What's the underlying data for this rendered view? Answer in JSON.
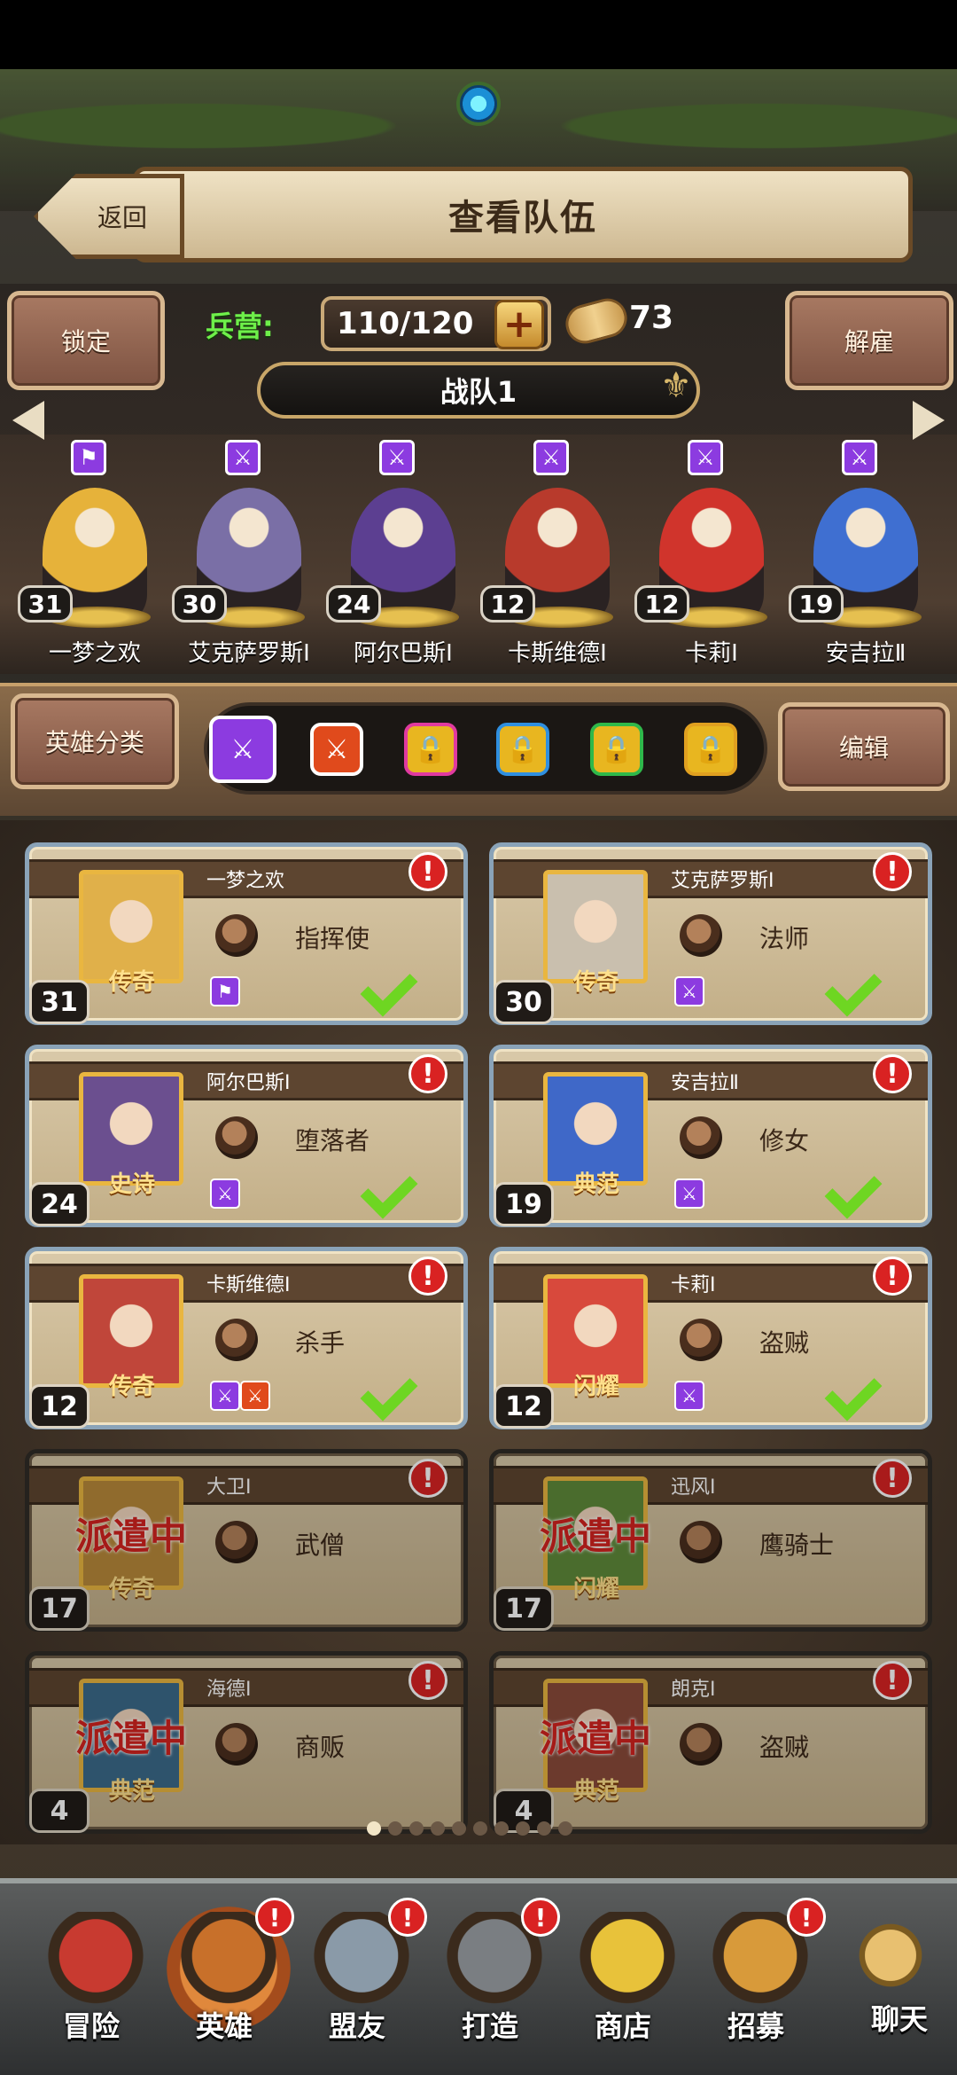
{
  "header": {
    "back_label": "返回",
    "title": "查看队伍",
    "lock_label": "锁定",
    "dismiss_label": "解雇",
    "barracks_label": "兵营:",
    "barracks_value": "110/120",
    "scroll_count": "73",
    "team_name": "战队1"
  },
  "lineup": [
    {
      "name": "一梦之欢",
      "level": "31",
      "tag": "flag",
      "color": "#e6b23a"
    },
    {
      "name": "艾克萨罗斯Ⅰ",
      "level": "30",
      "tag": "sword",
      "color": "#7a6fa6"
    },
    {
      "name": "阿尔巴斯Ⅰ",
      "level": "24",
      "tag": "sword",
      "color": "#5c3f91"
    },
    {
      "name": "卡斯维德Ⅰ",
      "level": "12",
      "tag": "sword",
      "color": "#b83a2c"
    },
    {
      "name": "卡莉Ⅰ",
      "level": "12",
      "tag": "sword",
      "color": "#d0342c"
    },
    {
      "name": "安吉拉Ⅱ",
      "level": "19",
      "tag": "sword",
      "color": "#3f6fd1"
    }
  ],
  "filter": {
    "category_label": "英雄分类",
    "edit_label": "编辑",
    "tabs": [
      {
        "icon": "sword-icon",
        "color": "#8c3be0",
        "locked": false
      },
      {
        "icon": "sword-icon",
        "color": "#e04a1c",
        "locked": false
      },
      {
        "icon": "lock-icon",
        "color": "#e03aa0",
        "locked": true
      },
      {
        "icon": "lock-icon",
        "color": "#2f8fe0",
        "locked": true
      },
      {
        "icon": "lock-icon",
        "color": "#2fb84a",
        "locked": true
      },
      {
        "icon": "lock-icon",
        "color": "#e0a020",
        "locked": true
      }
    ]
  },
  "heroes": [
    {
      "name": "一梦之欢",
      "job": "指挥使",
      "level": "31",
      "rank": "传奇",
      "portrait": "#e0b04a",
      "tags": [
        "flag"
      ],
      "status": "ready"
    },
    {
      "name": "艾克萨罗斯Ⅰ",
      "job": "法师",
      "level": "30",
      "rank": "传奇",
      "portrait": "#c9bfae",
      "tags": [
        "sword"
      ],
      "status": "ready"
    },
    {
      "name": "阿尔巴斯Ⅰ",
      "job": "堕落者",
      "level": "24",
      "rank": "史诗",
      "portrait": "#6b4f8f",
      "tags": [
        "sword"
      ],
      "status": "ready"
    },
    {
      "name": "安吉拉Ⅱ",
      "job": "修女",
      "level": "19",
      "rank": "典范",
      "portrait": "#3f68c8",
      "tags": [
        "sword"
      ],
      "status": "ready"
    },
    {
      "name": "卡斯维德Ⅰ",
      "job": "杀手",
      "level": "12",
      "rank": "传奇",
      "portrait": "#c0463a",
      "tags": [
        "sword",
        "sword-red"
      ],
      "status": "ready"
    },
    {
      "name": "卡莉Ⅰ",
      "job": "盗贼",
      "level": "12",
      "rank": "闪耀",
      "portrait": "#d8493c",
      "tags": [
        "sword"
      ],
      "status": "ready"
    },
    {
      "name": "大卫Ⅰ",
      "job": "武僧",
      "level": "17",
      "rank": "传奇",
      "portrait": "#b9893a",
      "tags": [],
      "status": "派遣中"
    },
    {
      "name": "迅风Ⅰ",
      "job": "鹰骑士",
      "level": "17",
      "rank": "闪耀",
      "portrait": "#5f8a3a",
      "tags": [],
      "status": "派遣中"
    },
    {
      "name": "海德Ⅰ",
      "job": "商贩",
      "level": "4",
      "rank": "典范",
      "portrait": "#3b6a8a",
      "tags": [],
      "status": "派遣中"
    },
    {
      "name": "朗克Ⅰ",
      "job": "盗贼",
      "level": "4",
      "rank": "典范",
      "portrait": "#8a4a3a",
      "tags": [],
      "status": "派遣中"
    }
  ],
  "pager": {
    "pages": 10,
    "current": 0
  },
  "nav": [
    {
      "label": "冒险",
      "icon": "crossed-swords-icon",
      "badge": false
    },
    {
      "label": "英雄",
      "icon": "knight-helmet-icon",
      "badge": true,
      "active": true
    },
    {
      "label": "盟友",
      "icon": "handshake-icon",
      "badge": true
    },
    {
      "label": "打造",
      "icon": "hammer-icon",
      "badge": true
    },
    {
      "label": "商店",
      "icon": "gold-bars-icon",
      "badge": false
    },
    {
      "label": "招募",
      "icon": "barrel-portal-icon",
      "badge": true
    },
    {
      "label": "聊天",
      "icon": "chat-bubble-icon",
      "badge": false
    }
  ],
  "alert_glyph": "!",
  "colors": {
    "accent_green": "#6ef04a",
    "alert_red": "#d92222",
    "dispatch_red": "#d4231f"
  }
}
